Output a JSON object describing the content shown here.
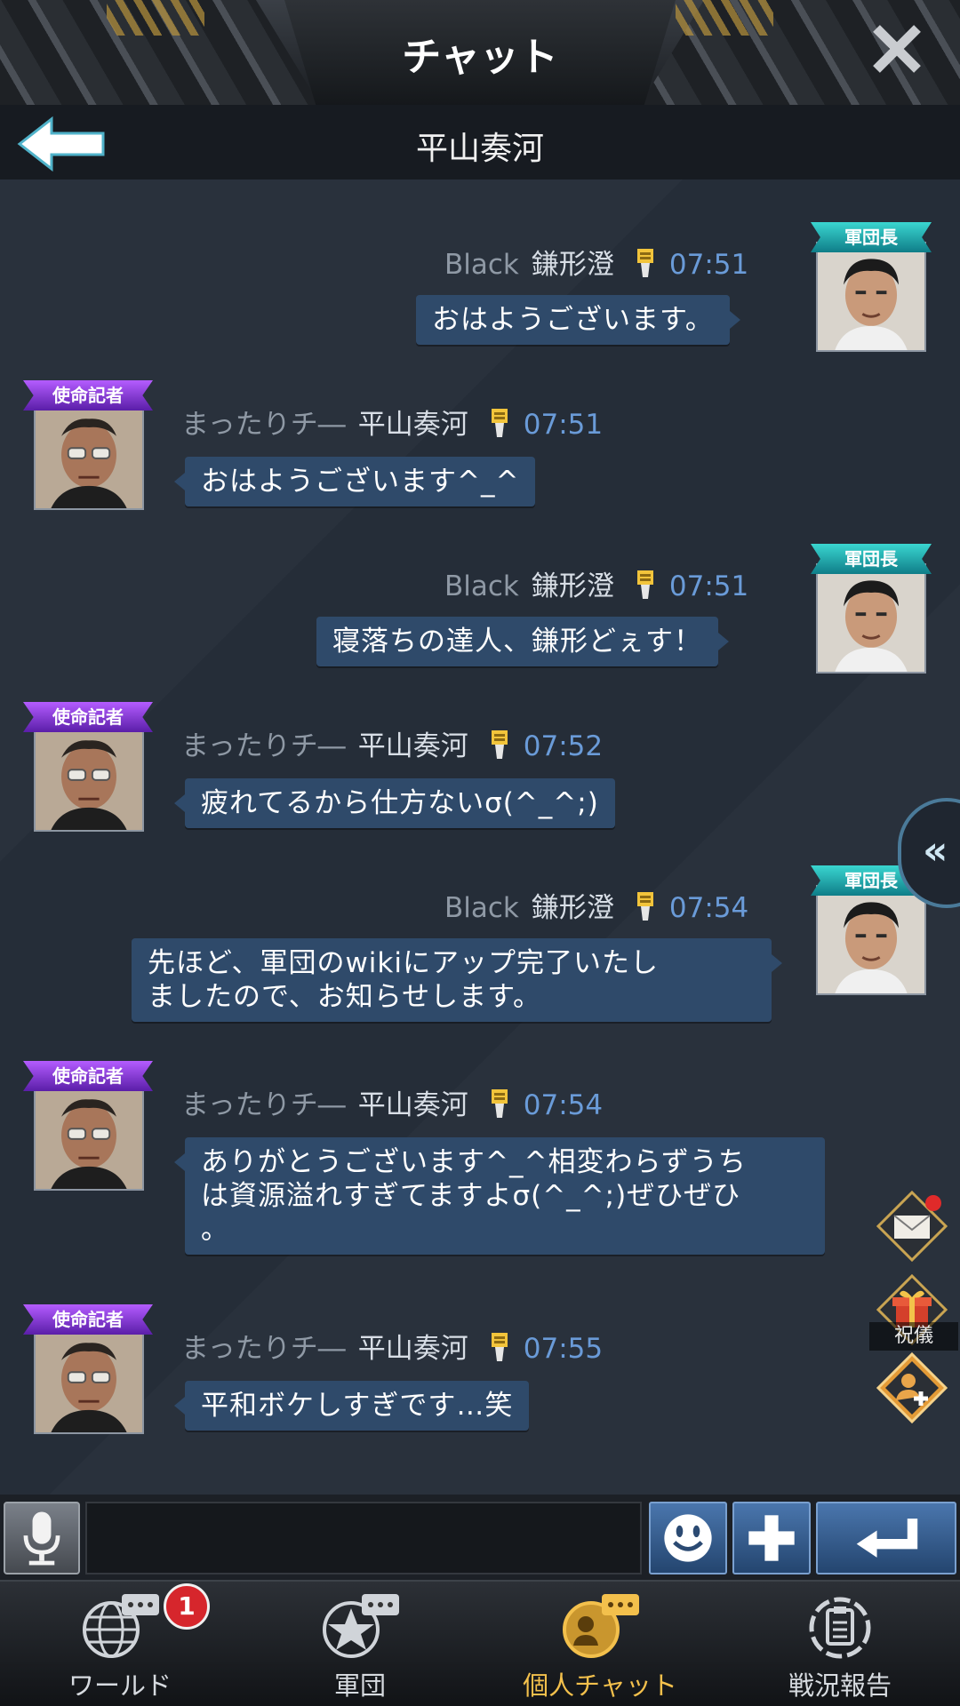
{
  "header": {
    "title": "チャット",
    "close_icon": "close-icon"
  },
  "subheader": {
    "title": "平山奏河",
    "back_icon": "back-arrow-icon"
  },
  "messages": [
    {
      "side": "right",
      "alliance": "Black",
      "name": "鎌形澄",
      "time": "07:51",
      "badge": "軍団長",
      "text": "おはようございます。"
    },
    {
      "side": "left",
      "alliance": "まったりチ―",
      "name": "平山奏河",
      "time": "07:51",
      "badge": "使命記者",
      "text": "おはようございます^_^"
    },
    {
      "side": "right",
      "alliance": "Black",
      "name": "鎌形澄",
      "time": "07:51",
      "badge": "軍団長",
      "text": "寝落ちの達人、鎌形どぇす！"
    },
    {
      "side": "left",
      "alliance": "まったりチ―",
      "name": "平山奏河",
      "time": "07:52",
      "badge": "使命記者",
      "text": "疲れてるから仕方ないσ(^_^;)"
    },
    {
      "side": "right",
      "alliance": "Black",
      "name": "鎌形澄",
      "time": "07:54",
      "badge": "軍団長",
      "text_lines": [
        "先ほど、軍団のwikiにアップ完了いたし",
        "ましたので、お知らせします。"
      ]
    },
    {
      "side": "left",
      "alliance": "まったりチ―",
      "name": "平山奏河",
      "time": "07:54",
      "badge": "使命記者",
      "text_lines": [
        "ありがとうございます^_^相変わらずうち",
        "は資源溢れすぎてますよσ(^_^;)ぜひぜひ",
        "。"
      ]
    },
    {
      "side": "left",
      "alliance": "まったりチ―",
      "name": "平山奏河",
      "time": "07:55",
      "badge": "使命記者",
      "text": "平和ボケしすぎです…笑"
    }
  ],
  "side_buttons": {
    "collapse": "«",
    "mail_icon": "mail-icon",
    "gift_label": "祝儀",
    "gift_icon": "gift-icon",
    "add_friend_icon": "add-friend-icon"
  },
  "input": {
    "value": "",
    "placeholder": "",
    "mic_icon": "microphone-icon",
    "emoji_icon": "smiley-icon",
    "plus_icon": "plus-icon",
    "send_icon": "enter-icon"
  },
  "nav": {
    "items": [
      {
        "label": "ワールド",
        "icon": "globe-chat-icon"
      },
      {
        "label": "軍団",
        "icon": "star-chat-icon"
      },
      {
        "label": "個人チャット",
        "icon": "personal-chat-icon"
      },
      {
        "label": "戦況報告",
        "icon": "report-icon"
      }
    ],
    "badge_count": "1"
  },
  "colors": {
    "bubble": "#2f4a6a",
    "time": "#6a9bd8",
    "active_nav": "#f3c04c",
    "leader_badge": "#1fa6ad",
    "mission_badge": "#7a34d6"
  }
}
